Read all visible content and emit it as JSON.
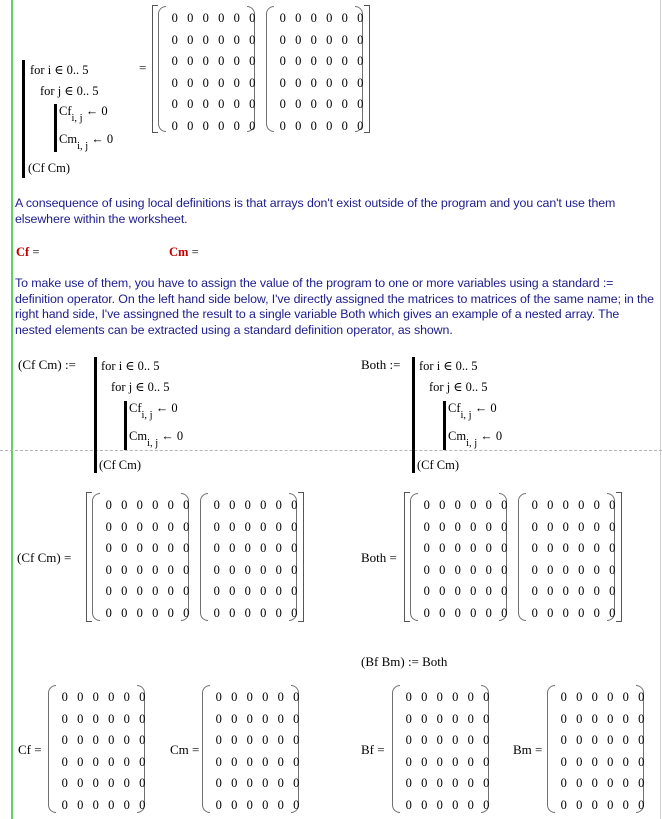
{
  "program": {
    "line1": "for  i ∈ 0.. 5",
    "line2": "for  j ∈ 0.. 5",
    "cf": "Cf",
    "cm": "Cm",
    "sub": "i, j",
    "assign": "← 0",
    "result": "(Cf   Cm)"
  },
  "top_eval": {
    "equals": "="
  },
  "para1": "A consequence of using local definitions is that arrays don't exist outside of the program and you can't use them elsewhere within the worksheet.",
  "undef_cf": {
    "name": "Cf",
    "eq": "="
  },
  "undef_cm": {
    "name": "Cm",
    "eq": "="
  },
  "para2": "To make use of them, you have to assign the value of the program to one or more variables using a standard := definition operator.  On the left hand side below, I've directly assigned the matrices to matrices of the same name; in the right hand side, I've assingned the result to a single variable Both which gives an example of a nested array.  The nested elements can be extracted using a standard definition operator, as shown.",
  "left_def": {
    "lhs": "(Cf   Cm) :="
  },
  "right_def": {
    "lhs": "Both :="
  },
  "left_eval": {
    "lhs": "(Cf   Cm) ="
  },
  "right_eval": {
    "lhs": "Both ="
  },
  "extract_def": "(Bf   Bm) := Both",
  "cf_eval": "Cf =",
  "cm_eval": "Cm =",
  "bf_eval": "Bf =",
  "bm_eval": "Bm =",
  "matrix_values": [
    [
      0,
      0,
      0,
      0,
      0,
      0
    ],
    [
      0,
      0,
      0,
      0,
      0,
      0
    ],
    [
      0,
      0,
      0,
      0,
      0,
      0
    ],
    [
      0,
      0,
      0,
      0,
      0,
      0
    ],
    [
      0,
      0,
      0,
      0,
      0,
      0
    ],
    [
      0,
      0,
      0,
      0,
      0,
      0
    ]
  ],
  "colors": {
    "text": "#1c1c8c",
    "undefined": "#c00000",
    "region_marker": "#5fd35f"
  }
}
